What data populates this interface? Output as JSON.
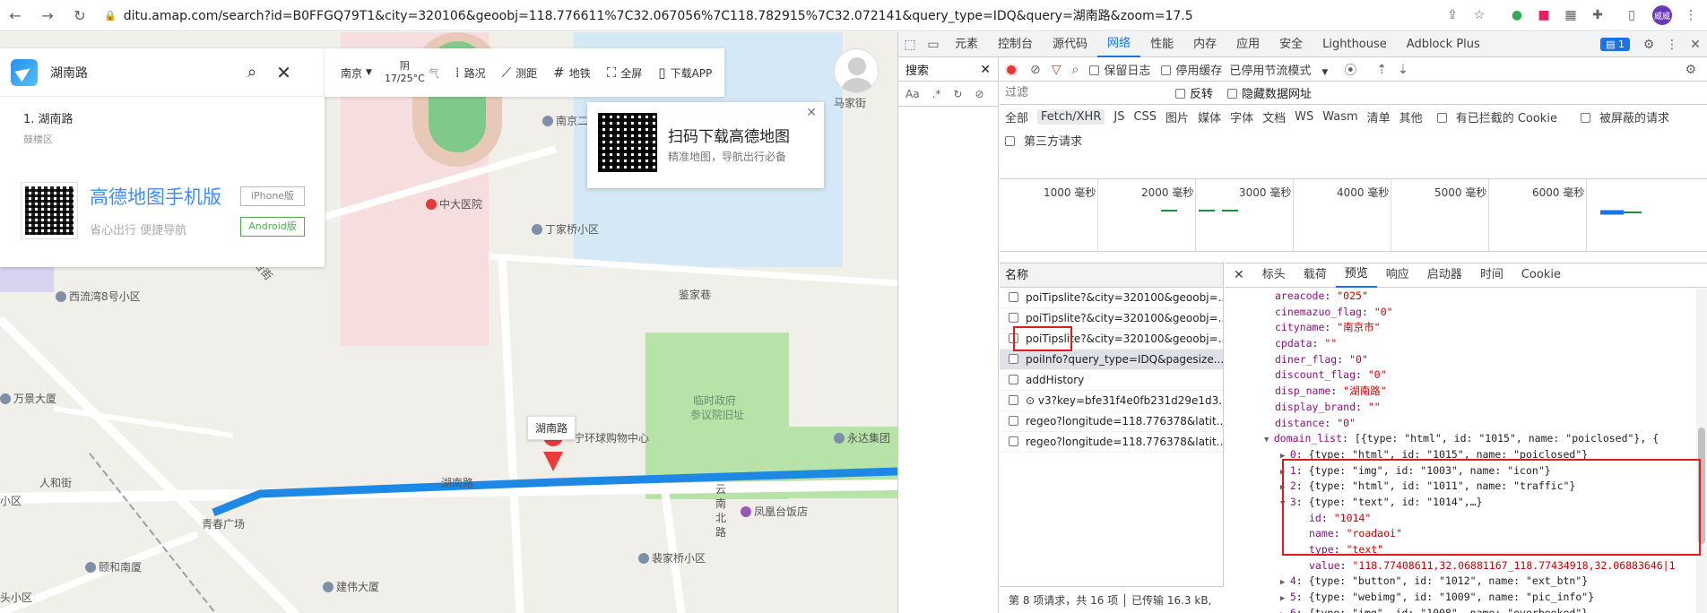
{
  "browser": {
    "url": "ditu.amap.com/search?id=B0FFGQ79T1&city=320106&geoobj=118.776611%7C32.067056%7C118.782915%7C32.072141&query_type=IDQ&query=湖南路&zoom=17.5",
    "profile_label": "威威"
  },
  "map": {
    "search": {
      "value": "湖南路",
      "result_label": "1. 湖南路",
      "result_district": "鼓楼区"
    },
    "promo": {
      "title": "高德地图手机版",
      "subtitle": "省心出行 便捷导航",
      "iphone_label": "iPhone版",
      "android_label": "Android版"
    },
    "toolbar": {
      "city": "南京",
      "weather_cond": "阴",
      "weather_temp": "17/25°C",
      "weather_suffix": "气",
      "traffic": "路况",
      "ranging": "测距",
      "subway": "地铁",
      "fullscreen": "全屏",
      "download": "下载APP"
    },
    "qr_popup": {
      "title": "扫码下载高德地图",
      "subtitle": "精准地图，导航出行必备"
    },
    "marker_label": "湖南路",
    "labels": {
      "majia": "马家街",
      "nanjing2": "南京二",
      "hospital": "中大医院",
      "dingjia": "丁家桥小区",
      "majie": "马台街",
      "xiliuwan": "西流湾8号小区",
      "jiexiang": "鉴家巷",
      "linshi": "临时政府",
      "canyi": "参议院旧址",
      "wanjing": "万景大厦",
      "huanqiu": "宁环球购物中心",
      "yongda": "永达集团",
      "renhe": "人和街",
      "hunan_road": "湖南路",
      "xiaoqu": "小区",
      "qingchun": "青春广场",
      "yunnan": "云南北路",
      "fenghuang": "凤凰台饭店",
      "yihe": "颐和南厦",
      "zhuangjia": "裴家桥小区",
      "jianwei": "建伟大厦",
      "toukou": "头小区"
    }
  },
  "devtools": {
    "tabs": [
      "元素",
      "控制台",
      "源代码",
      "网络",
      "性能",
      "内存",
      "应用",
      "安全",
      "Lighthouse",
      "Adblock Plus"
    ],
    "active_tab": "网络",
    "message_count": "1",
    "search_pane": {
      "title": "搜索",
      "opt_case": "Aa",
      "opt_regex": ".*"
    },
    "network_bar": {
      "preserve_log": "保留日志",
      "disable_cache": "停用缓存",
      "throttle": "已停用节流模式"
    },
    "filter": {
      "placeholder": "过滤",
      "invert": "反转",
      "hide_data": "隐藏数据网址"
    },
    "types": [
      "全部",
      "Fetch/XHR",
      "JS",
      "CSS",
      "图片",
      "媒体",
      "字体",
      "文档",
      "WS",
      "Wasm",
      "清单",
      "其他"
    ],
    "active_type": "Fetch/XHR",
    "blocked_cookies": "有已拦截的 Cookie",
    "blocked_requests": "被屏蔽的请求",
    "third_party": "第三方请求",
    "timeline_labels": [
      "1000 毫秒",
      "2000 毫秒",
      "3000 毫秒",
      "4000 毫秒",
      "5000 毫秒",
      "6000 毫秒"
    ],
    "list_header": "名称",
    "requests": [
      "poiTipslite?&city=320100&geoobj=...",
      "poiTipslite?&city=320100&geoobj=...",
      "poiTipslite?&city=320100&geoobj=...",
      "poiInfo?query_type=IDQ&pagesize...",
      "addHistory",
      "⊙ v3?key=bfe31f4e0fb231d29e1d3...",
      "regeo?longitude=118.776378&latit...",
      "regeo?longitude=118.776378&latit..."
    ],
    "selected_request": 3,
    "status": "第 8 项请求，共 16 项 │ 已传输 16.3 kB,",
    "detail_tabs": [
      "标头",
      "载荷",
      "预览",
      "响应",
      "启动器",
      "时间",
      "Cookie"
    ],
    "active_detail_tab": "预览",
    "json_lines": [
      {
        "indent": 0,
        "key": "areacode",
        "val": "\"025\""
      },
      {
        "indent": 0,
        "key": "cinemazuo_flag",
        "val": "\"0\""
      },
      {
        "indent": 0,
        "key": "cityname",
        "val": "\"南京市\""
      },
      {
        "indent": 0,
        "key": "cpdata",
        "val": "\"\""
      },
      {
        "indent": 0,
        "key": "diner_flag",
        "val": "\"0\""
      },
      {
        "indent": 0,
        "key": "discount_flag",
        "val": "\"0\""
      },
      {
        "indent": 0,
        "key": "disp_name",
        "val": "\"湖南路\""
      },
      {
        "indent": 0,
        "key": "display_brand",
        "val": "\"\""
      },
      {
        "indent": 0,
        "key": "distance",
        "val": "\"0\""
      },
      {
        "indent": 0,
        "arrow": "▼",
        "key": "domain_list",
        "plain": "[{type: \"html\", id: \"1015\", name: \"poiclosed\"}, {"
      },
      {
        "indent": 1,
        "arrow": "▶",
        "key": "0",
        "plain": "{type: \"html\", id: \"1015\", name: \"poiclosed\"}"
      },
      {
        "indent": 1,
        "arrow": "▶",
        "key": "1",
        "plain": "{type: \"img\", id: \"1003\", name: \"icon\"}"
      },
      {
        "indent": 1,
        "arrow": "▶",
        "key": "2",
        "plain": "{type: \"html\", id: \"1011\", name: \"traffic\"}"
      },
      {
        "indent": 1,
        "arrow": "▼",
        "key": "3",
        "plain": "{type: \"text\", id: \"1014\",…}"
      },
      {
        "indent": 2,
        "key": "id",
        "val": "\"1014\""
      },
      {
        "indent": 2,
        "key": "name",
        "val": "\"roadaoi\""
      },
      {
        "indent": 2,
        "key": "type",
        "val": "\"text\""
      },
      {
        "indent": 2,
        "key": "value",
        "val": "\"118.77408611,32.06881167_118.77434918,32.06883646|1"
      },
      {
        "indent": 1,
        "arrow": "▶",
        "key": "4",
        "plain": "{type: \"button\", id: \"1012\", name: \"ext_btn\"}"
      },
      {
        "indent": 1,
        "arrow": "▶",
        "key": "5",
        "plain": "{type: \"webimg\", id: \"1009\", name: \"pic_info\"}"
      },
      {
        "indent": 1,
        "arrow": "▶",
        "key": "6",
        "plain": "{type: \"img\", id: \"1008\", name: \"overbooked\"}"
      }
    ]
  },
  "colors": {
    "route": "#1e88e5",
    "highlight": "#e01b1b",
    "devtools_accent": "#1a73e8"
  }
}
